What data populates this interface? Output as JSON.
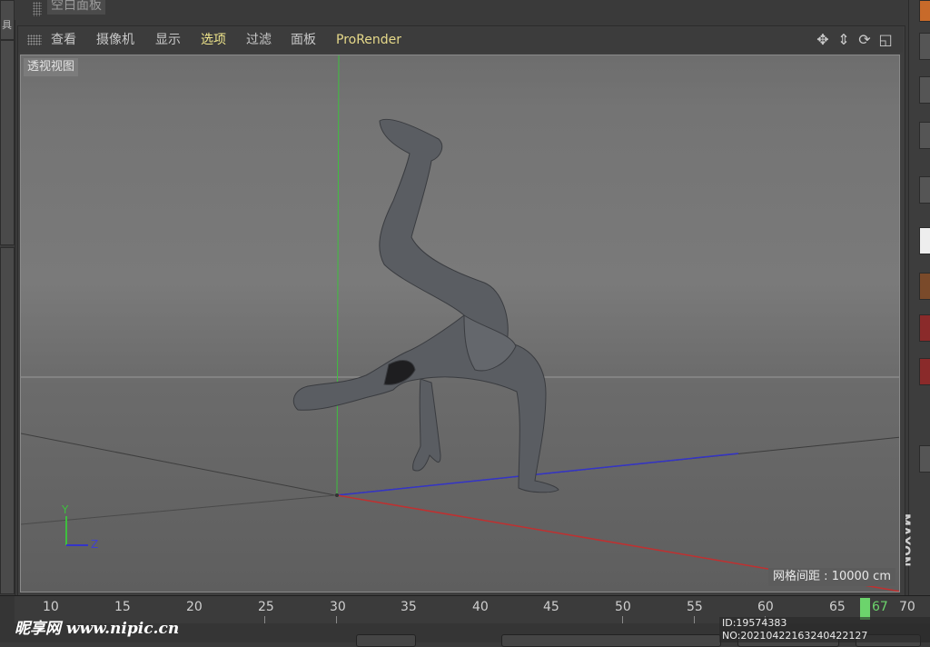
{
  "top_panel": {
    "title": "空白面板"
  },
  "left_panel": {
    "label": "具"
  },
  "menubar": {
    "items": [
      "查看",
      "摄像机",
      "显示",
      "选项",
      "过滤",
      "面板",
      "ProRender"
    ],
    "active_index": 3,
    "nav_icons": [
      "move-icon",
      "dolly-icon",
      "rotate-icon",
      "maximize-icon"
    ]
  },
  "viewport": {
    "label": "透视视图",
    "grid_spacing": "网格间距 : 10000 cm",
    "axis_labels": {
      "y": "Y",
      "z": "Z"
    },
    "colors": {
      "y_axis": "#3fbf3f",
      "x_axis": "#c03030",
      "z_axis": "#3030c0"
    }
  },
  "timeline": {
    "ticks": [
      "10",
      "15",
      "20",
      "25",
      "30",
      "35",
      "40",
      "45",
      "50",
      "55",
      "60",
      "65",
      "70"
    ],
    "current_frame": "67",
    "playhead_color": "#6cd46c"
  },
  "watermark": {
    "site": "昵享网 www.nipic.cn",
    "id_text": "ID:19574383 NO:20210422163240422127"
  },
  "brand": "MAXON"
}
